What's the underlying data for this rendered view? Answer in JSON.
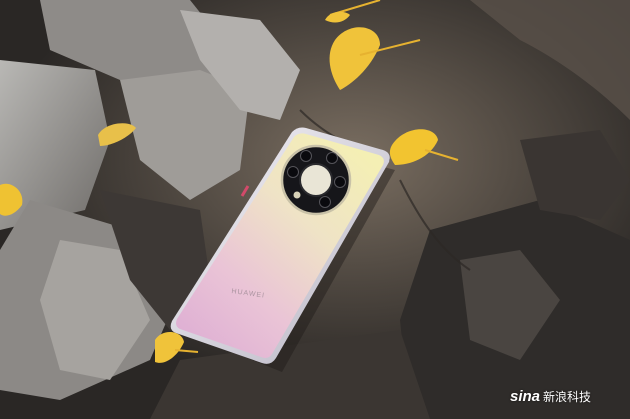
{
  "image": {
    "phone_brand": "HUAWEI",
    "watermark_logo": "sina",
    "watermark_text": "新浪科技"
  },
  "colors": {
    "rock_dark": "#2f2c29",
    "rock_mid": "#6e6760",
    "rock_light": "#a8a6a2",
    "phone_frame": "#d9d6e0",
    "phone_gold": "#f1e9b0",
    "phone_pink": "#e9b7cf",
    "leaf": "#f0c33a",
    "camera_ring": "#16161a"
  },
  "icons": {
    "camera": "camera-module-icon",
    "logo": "sina-logo-icon"
  }
}
